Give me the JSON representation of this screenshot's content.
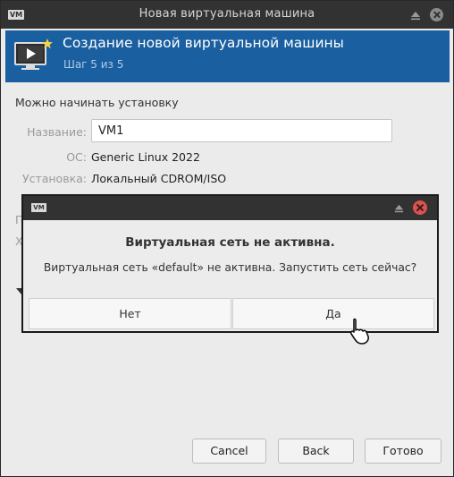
{
  "window": {
    "title": "Новая виртуальная машина",
    "app_icon_text": "VM"
  },
  "banner": {
    "title": "Создание новой виртуальной машины",
    "step": "Шаг 5 из 5",
    "color": "#1a5fa0"
  },
  "summary": {
    "heading": "Можно начинать установку",
    "name_label": "Название:",
    "name_value": "VM1",
    "os_label": "ОС:",
    "os_value": "Generic Linux 2022",
    "install_label": "Установка:",
    "install_value": "Локальный CDROM/ISO",
    "hidden_fragments": [
      "П",
      "Х"
    ]
  },
  "footer": {
    "cancel": "Cancel",
    "back": "Back",
    "finish": "Готово"
  },
  "dialog": {
    "app_icon_text": "VM",
    "heading": "Виртуальная сеть не активна.",
    "message": "Виртуальная сеть «default» не активна. Запустить сеть сейчас?",
    "no": "Нет",
    "yes": "Да",
    "close_color": "#d9534f"
  }
}
